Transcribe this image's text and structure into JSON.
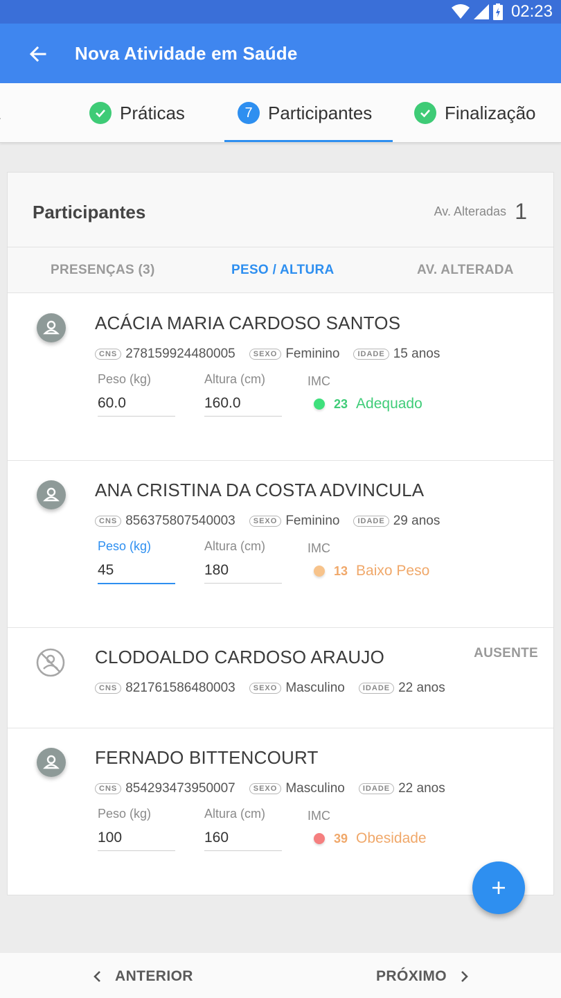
{
  "status_bar": {
    "time": "02:23"
  },
  "app_bar": {
    "title": "Nova Atividade em Saúde"
  },
  "steps": [
    {
      "label": "a",
      "state": "done"
    },
    {
      "label": "Práticas",
      "state": "done"
    },
    {
      "label": "Participantes",
      "number": "7",
      "state": "active"
    },
    {
      "label": "Finalização",
      "state": "done"
    }
  ],
  "panel": {
    "title": "Participantes",
    "altered_label": "Av. Alteradas",
    "altered_count": "1",
    "tabs": [
      "PRESENÇAS (3)",
      "PESO / ALTURA",
      "AV. ALTERADA"
    ],
    "active_tab": "PESO / ALTURA"
  },
  "labels": {
    "cns_tag": "CNS",
    "sexo_tag": "SEXO",
    "idade_tag": "IDADE",
    "peso": "Peso (kg)",
    "altura": "Altura (cm)",
    "imc": "IMC",
    "absent": "AUSENTE"
  },
  "participants": [
    {
      "name": "ACÁCIA MARIA CARDOSO SANTOS",
      "cns": "278159924480005",
      "sexo": "Feminino",
      "idade": "15 anos",
      "peso": "60.0",
      "altura": "160.0",
      "imc_value": "23",
      "imc_class": "Adequado",
      "imc_color": "#3fcc78",
      "present": true
    },
    {
      "name": "ANA CRISTINA DA COSTA ADVINCULA",
      "cns": "856375807540003",
      "sexo": "Feminino",
      "idade": "29 anos",
      "peso": "45",
      "altura": "180",
      "imc_value": "13",
      "imc_class": "Baixo Peso",
      "imc_color": "#f0a86a",
      "dot_color": "#f7c38b",
      "present": true,
      "focused": true
    },
    {
      "name": "CLODOALDO CARDOSO ARAUJO",
      "cns": "821761586480003",
      "sexo": "Masculino",
      "idade": "22 anos",
      "present": false
    },
    {
      "name": "FERNADO BITTENCOURT",
      "cns": "854293473950007",
      "sexo": "Masculino",
      "idade": "22 anos",
      "peso": "100",
      "altura": "160",
      "imc_value": "39",
      "imc_class": "Obesidade",
      "imc_color": "#f0a86a",
      "dot_color": "#f57f7f",
      "present": true
    }
  ],
  "bottom_nav": {
    "previous": "ANTERIOR",
    "next": "PRÓXIMO"
  },
  "colors": {
    "primary": "#3f86ef",
    "accent": "#2e8ff0",
    "status_bar": "#3a6fd8"
  }
}
